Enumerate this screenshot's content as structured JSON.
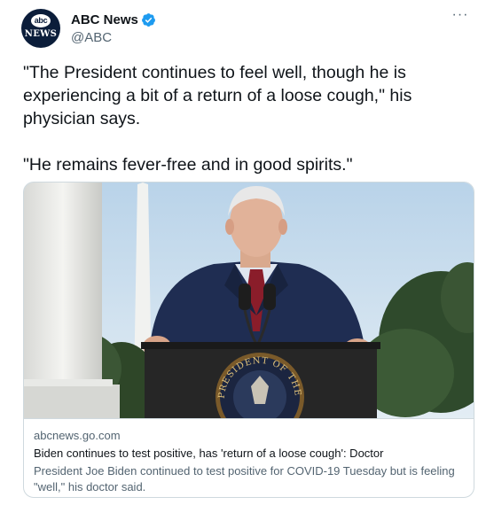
{
  "account": {
    "display_name": "ABC News",
    "handle": "@ABC",
    "avatar_mark": "abc",
    "avatar_word": "NEWS",
    "verified": true,
    "more_label": "···"
  },
  "tweet": {
    "text": "\"The President continues to feel well, though he is experiencing a bit of a return of a loose cough,\" his physician says.\n\n\"He remains fever-free and in good spirits.\""
  },
  "card": {
    "domain": "abcnews.go.com",
    "title": "Biden continues to test positive, has 'return of a loose cough': Doctor",
    "description": "President Joe Biden continued to test positive for COVID-19 Tuesday but is feeling \"well,\" his doctor said.",
    "seal_text": "PRESIDENT OF THE UNITED"
  },
  "colors": {
    "verified": "#1d9bf0",
    "secondary_text": "#536471",
    "border": "#cfd9de"
  }
}
